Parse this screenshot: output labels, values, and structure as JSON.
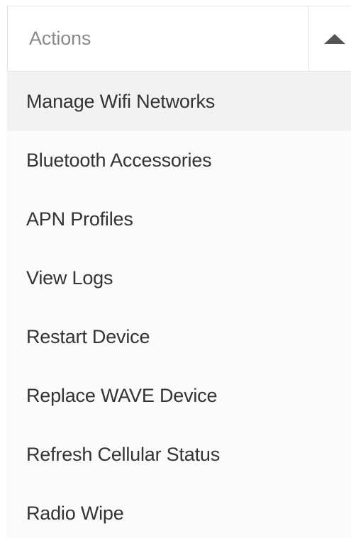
{
  "dropdown": {
    "header_label": "Actions",
    "toggle_icon": "caret-up-icon",
    "items": [
      {
        "label": "Manage Wifi Networks",
        "highlighted": true
      },
      {
        "label": "Bluetooth Accessories"
      },
      {
        "label": "APN Profiles"
      },
      {
        "label": "View Logs"
      },
      {
        "label": "Restart Device"
      },
      {
        "label": "Replace WAVE Device"
      },
      {
        "label": "Refresh Cellular Status"
      },
      {
        "label": "Radio Wipe"
      }
    ]
  },
  "colors": {
    "header_text": "#8a8a8a",
    "item_text": "#333333",
    "highlight_bg": "#f2f2f2",
    "menu_bg": "#fbfbfb",
    "caret": "#555555"
  }
}
